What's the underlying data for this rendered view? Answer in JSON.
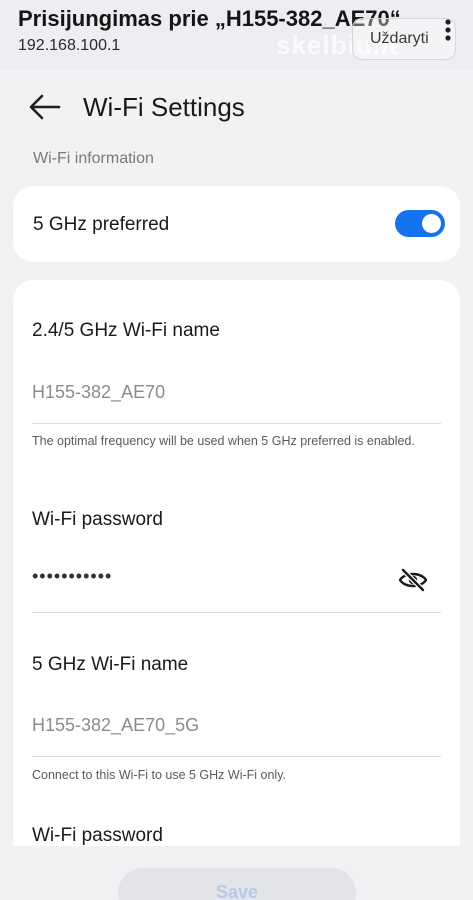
{
  "topbar": {
    "title": "Prisijungimas prie „H155-382_AE70“",
    "url": "192.168.100.1",
    "close_label": "Uždaryti",
    "watermark": "skelbiu.lt"
  },
  "header": {
    "title": "Wi-Fi Settings"
  },
  "section": {
    "label": "Wi-Fi information"
  },
  "pref": {
    "label": "5 GHz preferred",
    "enabled": true,
    "accent_color": "#1672ee"
  },
  "fields": {
    "name_24": {
      "title": "2.4/5 GHz Wi-Fi name",
      "value": "H155-382_AE70",
      "hint": "The optimal frequency will be used when 5 GHz preferred is enabled."
    },
    "password_1": {
      "title": "Wi-Fi password",
      "value": "•••••••••••"
    },
    "name_5": {
      "title": "5 GHz Wi-Fi name",
      "value": "H155-382_AE70_5G",
      "hint": "Connect to this Wi-Fi to use 5 GHz Wi-Fi only."
    },
    "password_2": {
      "title": "Wi-Fi password"
    }
  },
  "footer": {
    "save_label": "Save"
  },
  "icons": {
    "back": "arrow-left-icon",
    "eye": "eye-off-icon",
    "menu": "more-vertical-icon"
  }
}
